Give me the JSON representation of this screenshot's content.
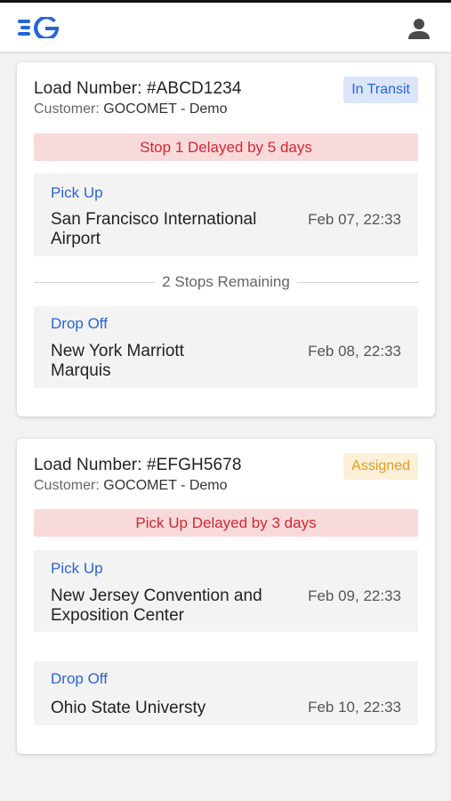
{
  "header": {
    "logo_icon": "gocomet-logo",
    "user_icon": "user-icon",
    "brand_color": "#2563d9"
  },
  "loads": [
    {
      "title": "Load Number: #ABCD1234",
      "customer_label": "Customer:",
      "customer_name": "GOCOMET - Demo",
      "status": "In Transit",
      "alert": "Stop 1 Delayed by 5 days",
      "pickup": {
        "type": "Pick Up",
        "name": "San Francisco International Airport",
        "date": "Feb 07, 22:33"
      },
      "stops_remaining": "2 Stops Remaining",
      "dropoff": {
        "type": "Drop Off",
        "name": "New York Marriott Marquis",
        "date": "Feb 08, 22:33"
      }
    },
    {
      "title": "Load Number: #EFGH5678",
      "customer_label": "Customer:",
      "customer_name": "GOCOMET - Demo",
      "status": "Assigned",
      "alert": "Pick Up Delayed by 3 days",
      "pickup": {
        "type": "Pick Up",
        "name": "New Jersey Convention and Exposition Center",
        "date": "Feb 09, 22:33"
      },
      "dropoff": {
        "type": "Drop Off",
        "name": "Ohio State Universty",
        "date": "Feb 10, 22:33"
      }
    }
  ]
}
